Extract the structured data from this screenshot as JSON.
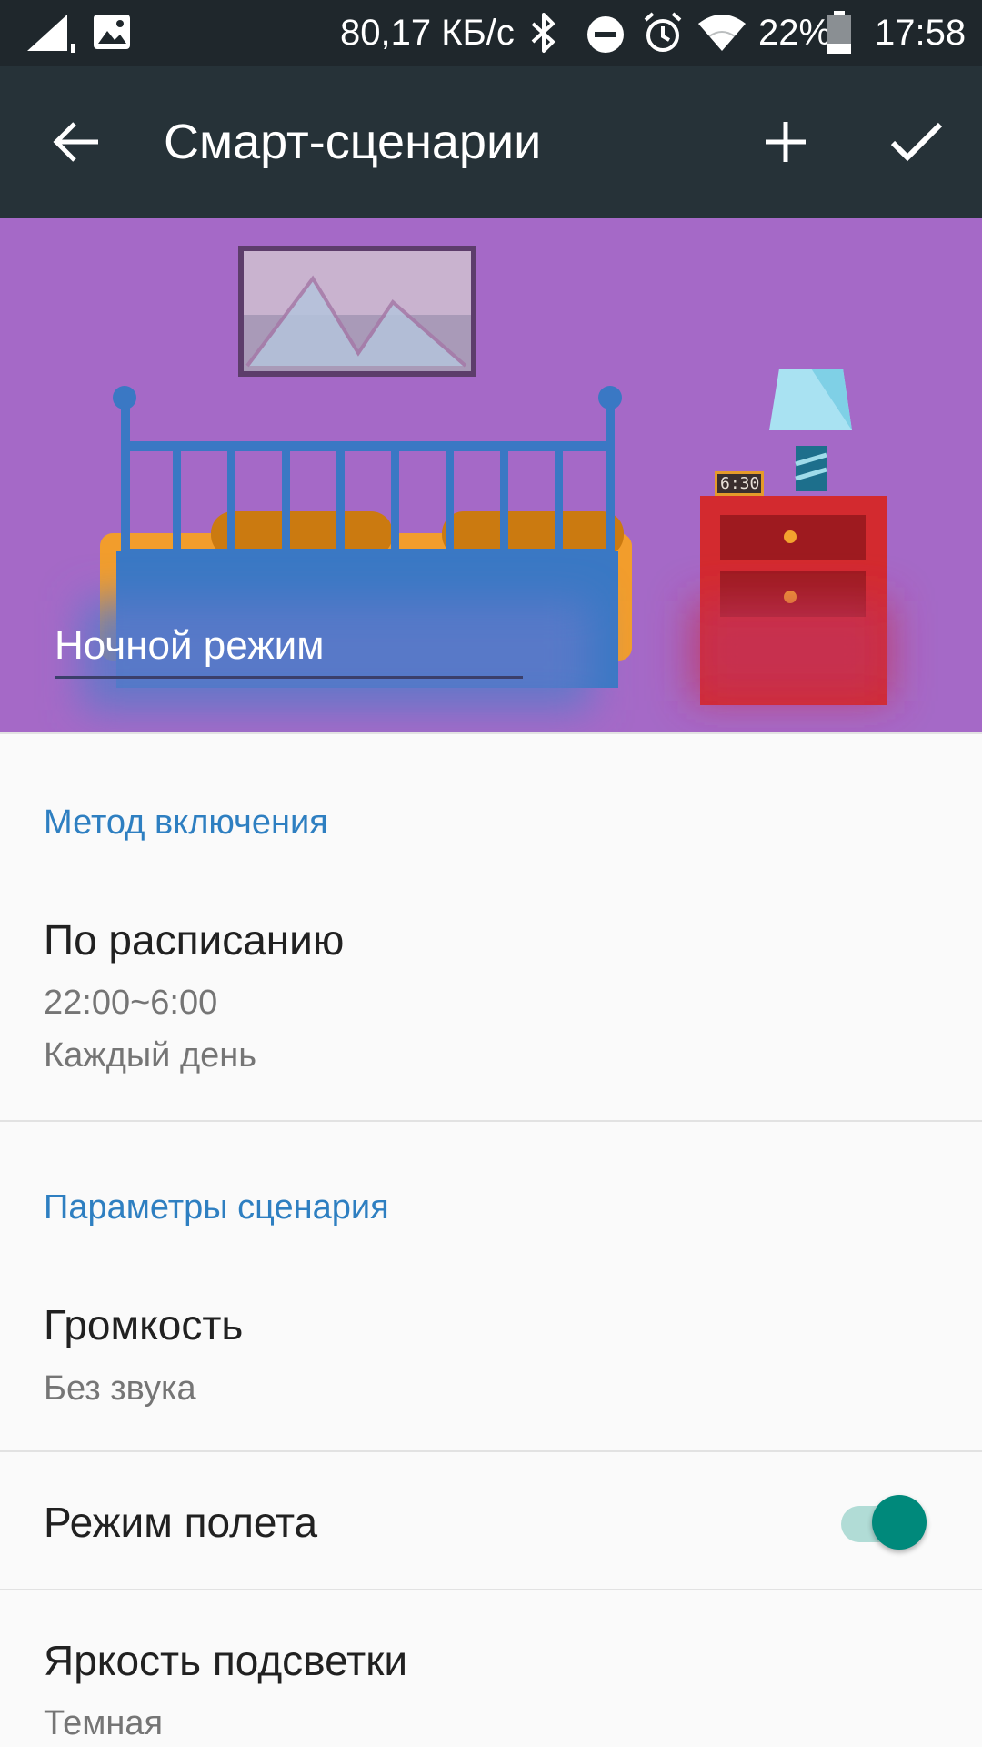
{
  "status_bar": {
    "net_speed": "80,17 КБ/с",
    "battery": "22%",
    "time": "17:58"
  },
  "app_bar": {
    "title": "Смарт-сценарии"
  },
  "banner": {
    "clock_time": "6:30",
    "scene_name": "Ночной режим"
  },
  "sections": {
    "activation": {
      "header": "Метод включения",
      "schedule_title": "По расписанию",
      "schedule_time": "22:00~6:00",
      "schedule_repeat": "Каждый день"
    },
    "params": {
      "header": "Параметры сценария",
      "volume_title": "Громкость",
      "volume_value": "Без звука",
      "airplane_title": "Режим полета",
      "airplane_enabled": true,
      "brightness_title": "Яркость подсветки",
      "brightness_value": "Темная"
    }
  },
  "colors": {
    "accent": "#00897b",
    "section_header": "#2e7fc1",
    "app_bar": "#263238",
    "banner": "#a569c7"
  }
}
